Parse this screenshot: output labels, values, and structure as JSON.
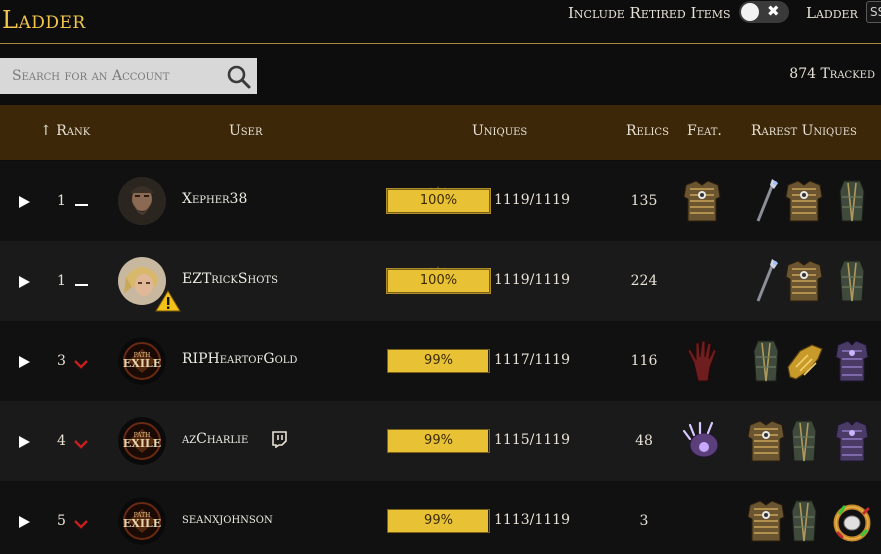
{
  "header": {
    "title": "Ladder",
    "include_retired_label": "Include Retired Items",
    "toggle_icon": "close-icon",
    "ladder_label": "Ladder",
    "league_value": "SSF"
  },
  "search": {
    "placeholder": "Search for an Account",
    "value": ""
  },
  "tracked": "874 Tracked",
  "columns": {
    "rank": "Rank",
    "user": "User",
    "uniques": "Uniques",
    "relics": "Relics",
    "feat": "Feat.",
    "rarest": "Rarest Uniques"
  },
  "colors": {
    "accent": "#f2c64a",
    "header_band": "#3d2709",
    "progress_fill": "#e8c234",
    "rank_down": "#c81e1e"
  },
  "rows": [
    {
      "rank": "1",
      "trend": "same",
      "avatar": "bearded-warrior-avatar",
      "warning": false,
      "twitch": false,
      "name": "Xepher38",
      "progress": 1.0,
      "percent": "100%",
      "uniques": "1119/1119",
      "relics": "135",
      "feat": "chest-armour-icon",
      "rarest": [
        "staff-icon",
        "chest-armour-icon",
        "robe-icon"
      ]
    },
    {
      "rank": "1",
      "trend": "same",
      "avatar": "blonde-hero-avatar",
      "warning": true,
      "twitch": false,
      "name": "EZTrickShots",
      "progress": 1.0,
      "percent": "100%",
      "uniques": "1119/1119",
      "relics": "224",
      "feat": null,
      "rarest": [
        "staff-icon",
        "chest-armour-icon",
        "robe-icon"
      ]
    },
    {
      "rank": "3",
      "trend": "down",
      "avatar": "poe-exile-logo",
      "warning": false,
      "twitch": false,
      "name": "RIPHeartofGold",
      "progress": 0.99,
      "percent": "99%",
      "uniques": "1117/1119",
      "relics": "116",
      "feat": "bloody-hand-icon",
      "rarest": [
        "robe-icon",
        "gold-gauntlet-icon",
        "purple-armour-icon"
      ]
    },
    {
      "rank": "4",
      "trend": "down",
      "avatar": "poe-exile-logo",
      "warning": false,
      "twitch": true,
      "name": "azCharlie",
      "progress": 0.99,
      "percent": "99%",
      "uniques": "1115/1119",
      "relics": "48",
      "feat": "purple-claw-icon",
      "rarest": [
        "chest-armour-icon",
        "robe-icon",
        "purple-armour-icon"
      ]
    },
    {
      "rank": "5",
      "trend": "down",
      "avatar": "poe-exile-logo",
      "warning": false,
      "twitch": false,
      "name": "seanxjohnson",
      "progress": 0.99,
      "percent": "99%",
      "uniques": "1113/1119",
      "relics": "3",
      "feat": null,
      "rarest": [
        "chest-armour-icon",
        "robe-icon",
        "gem-ring-icon"
      ]
    }
  ]
}
